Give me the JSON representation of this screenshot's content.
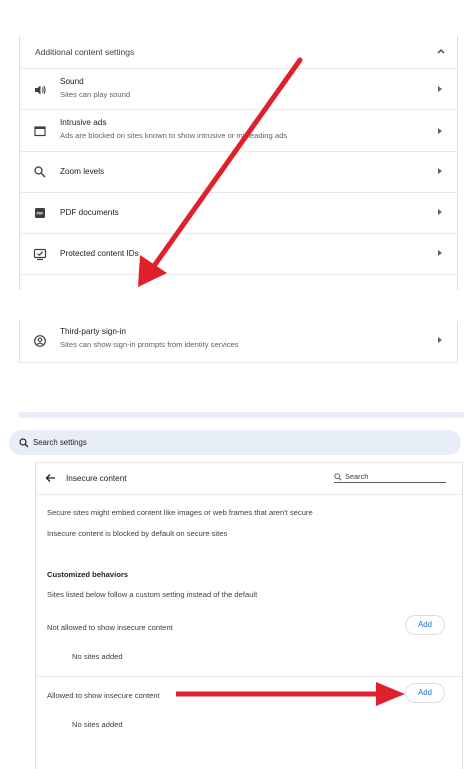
{
  "additional": {
    "title": "Additional content settings",
    "rows": [
      {
        "icon": "speaker-icon",
        "title": "Sound",
        "subtitle": "Sites can play sound"
      },
      {
        "icon": "ad-icon",
        "title": "Intrusive ads",
        "subtitle": "Ads are blocked on sites known to show intrusive or misleading ads"
      },
      {
        "icon": "search-icon",
        "title": "Zoom levels",
        "subtitle": ""
      },
      {
        "icon": "pdf-icon",
        "title": "PDF documents",
        "subtitle": ""
      },
      {
        "icon": "protected-content-icon",
        "title": "Protected content IDs",
        "subtitle": ""
      }
    ],
    "third_party": {
      "icon": "account-icon",
      "title": "Third-party sign-in",
      "subtitle": "Sites can show sign-in prompts from identity services"
    }
  },
  "search_settings": {
    "label": "Search settings"
  },
  "insecure": {
    "title": "Insecure content",
    "search_label": "Search",
    "desc1": "Secure sites might embed content like images or web frames that aren't secure",
    "desc2": "Insecure content is blocked by default on secure sites",
    "customized_heading": "Customized behaviors",
    "customized_desc": "Sites listed below follow a custom setting instead of the default",
    "not_allowed_label": "Not allowed to show insecure content",
    "not_allowed_empty": "No sites added",
    "allowed_label": "Allowed to show insecure content",
    "allowed_empty": "No sites added",
    "add_label": "Add"
  },
  "colors": {
    "annotation_arrow": "#e0202a",
    "accent": "#1a73e8"
  }
}
